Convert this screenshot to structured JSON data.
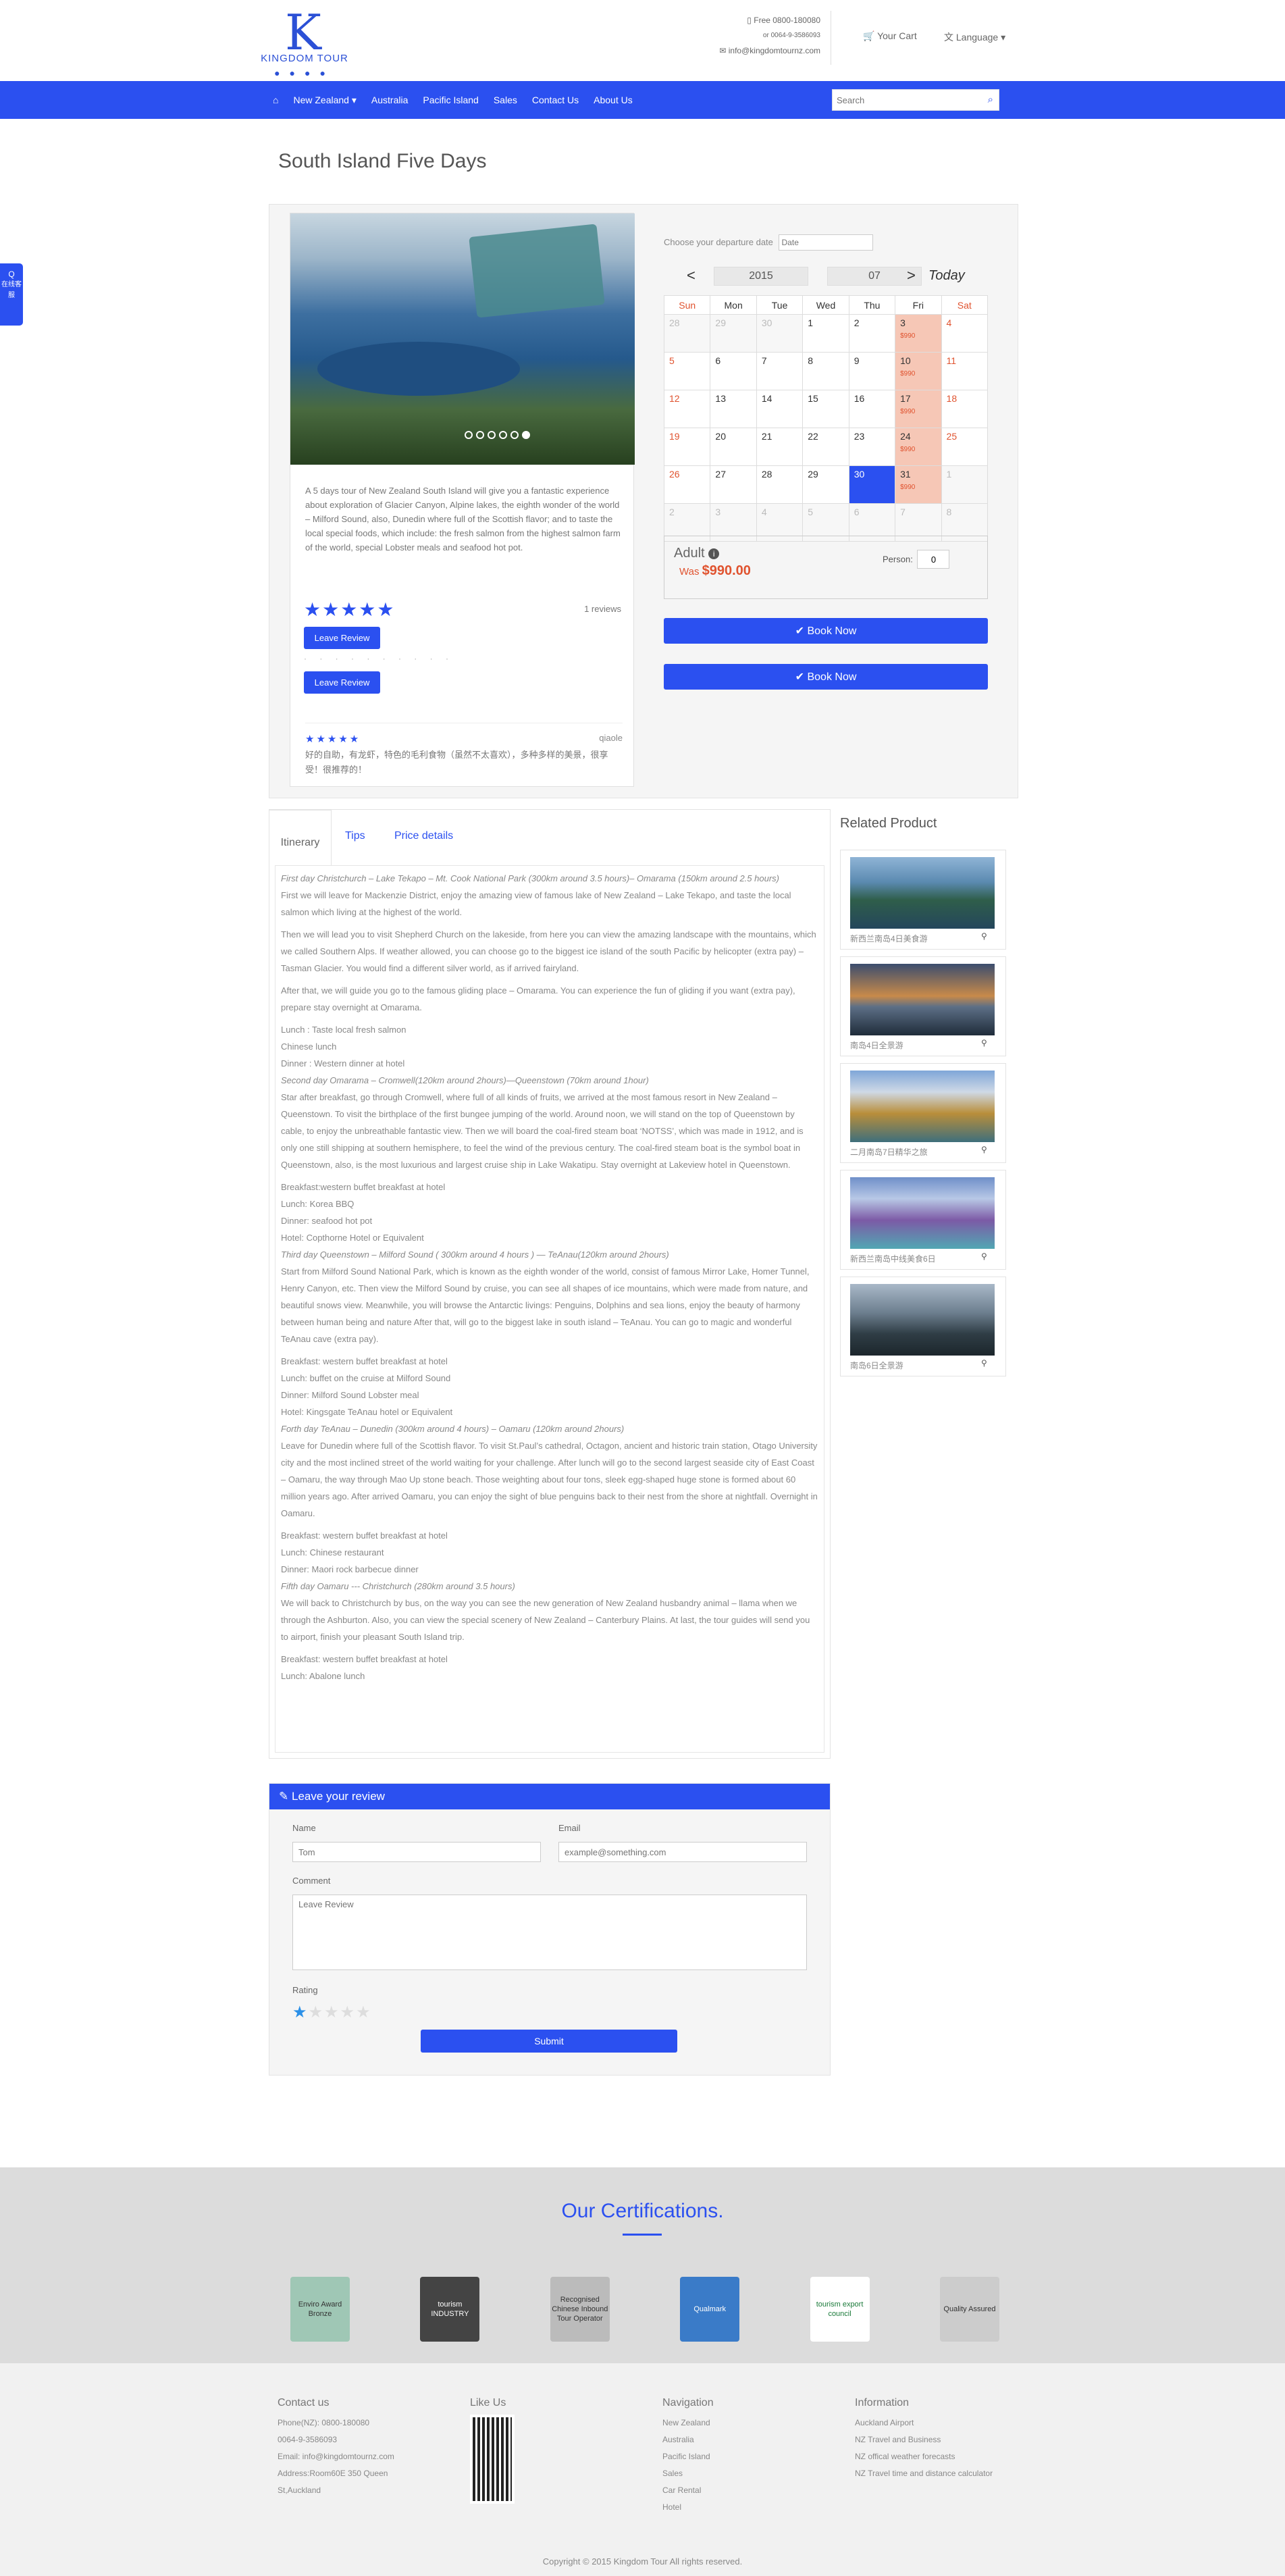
{
  "header": {
    "logo_text": "KINGDOM TOUR",
    "phone_free": "Free 0800-180080",
    "phone_intl": "or 0064-9-3586093",
    "email": "info@kingdomtournz.com",
    "cart": "Your Cart",
    "language": "Language"
  },
  "nav": {
    "items": [
      "New Zealand",
      "Australia",
      "Pacific Island",
      "Sales",
      "Contact Us",
      "About Us"
    ],
    "search_placeholder": "Search"
  },
  "side_tab": "在线客服",
  "page_title": "South Island Five Days",
  "product": {
    "description": "A 5 days tour of New Zealand South Island will give you a fantastic experience about exploration of Glacier Canyon, Alpine lakes, the eighth wonder of the world – Milford Sound, also, Dunedin where full of the Scottish flavor; and to taste the local special foods, which include: the fresh salmon from the highest salmon farm of the world, special Lobster meals and seafood hot pot.",
    "rating_stars": 5,
    "reviews_count": "1 reviews",
    "leave_review_label": "Leave Review",
    "review": {
      "stars": 5,
      "author": "qiaole",
      "text": "好的自助，有龙虾，特色的毛利食物（虽然不太喜欢），多种多样的美景，很享受！很推荐的！"
    }
  },
  "booking": {
    "choose_date_label": "Choose your departure date",
    "date_placeholder": "Date",
    "year": "2015",
    "month": "07",
    "prev": "<",
    "next": ">",
    "today": "Today",
    "weekdays": [
      "Sun",
      "Mon",
      "Tue",
      "Wed",
      "Thu",
      "Fri",
      "Sat"
    ],
    "weeks": [
      [
        {
          "d": "28",
          "o": true
        },
        {
          "d": "29",
          "o": true
        },
        {
          "d": "30",
          "o": true
        },
        {
          "d": "1"
        },
        {
          "d": "2"
        },
        {
          "d": "3",
          "a": true,
          "p": "$990"
        },
        {
          "d": "4"
        }
      ],
      [
        {
          "d": "5"
        },
        {
          "d": "6"
        },
        {
          "d": "7"
        },
        {
          "d": "8"
        },
        {
          "d": "9"
        },
        {
          "d": "10",
          "a": true,
          "p": "$990"
        },
        {
          "d": "11"
        }
      ],
      [
        {
          "d": "12"
        },
        {
          "d": "13"
        },
        {
          "d": "14"
        },
        {
          "d": "15"
        },
        {
          "d": "16"
        },
        {
          "d": "17",
          "a": true,
          "p": "$990"
        },
        {
          "d": "18"
        }
      ],
      [
        {
          "d": "19"
        },
        {
          "d": "20"
        },
        {
          "d": "21"
        },
        {
          "d": "22"
        },
        {
          "d": "23"
        },
        {
          "d": "24",
          "a": true,
          "p": "$990"
        },
        {
          "d": "25"
        }
      ],
      [
        {
          "d": "26"
        },
        {
          "d": "27"
        },
        {
          "d": "28"
        },
        {
          "d": "29"
        },
        {
          "d": "30",
          "s": true
        },
        {
          "d": "31",
          "a": true,
          "p": "$990"
        },
        {
          "d": "1",
          "o": true
        }
      ],
      [
        {
          "d": "2",
          "o": true
        },
        {
          "d": "3",
          "o": true
        },
        {
          "d": "4",
          "o": true
        },
        {
          "d": "5",
          "o": true
        },
        {
          "d": "6",
          "o": true
        },
        {
          "d": "7",
          "o": true
        },
        {
          "d": "8",
          "o": true
        }
      ]
    ],
    "adult_label": "Adult",
    "was_label": "Was",
    "price": "$990.00",
    "person_label": "Person",
    "person_value": "0",
    "book_label": "Book Now"
  },
  "tabs": [
    "Itinerary",
    "Tips",
    "Price details"
  ],
  "itinerary": [
    {
      "day": "First day    Christchurch – Lake Tekapo – Mt. Cook National Park (300km around 3.5 hours)– Omarama (150km around 2.5 hours)",
      "paras": [
        "First we will leave for Mackenzie District, enjoy the amazing view of famous lake of New Zealand – Lake Tekapo, and taste the local salmon which living at the highest of the world.",
        "Then we will lead you to visit Shepherd Church on the lakeside, from here you can view the amazing landscape with the mountains, which we called Southern Alps. If weather allowed, you can choose go to the biggest ice island of the south Pacific by helicopter (extra pay) – Tasman Glacier. You would find a different silver world, as if arrived fairyland.",
        "After that, we will guide you go to the famous gliding place – Omarama. You can experience the fun of gliding if you want (extra pay), prepare stay overnight at Omarama."
      ],
      "meals": [
        "Lunch : Taste local fresh salmon",
        "Chinese lunch",
        "Dinner : Western dinner at hotel"
      ]
    },
    {
      "day": "Second day    Omarama – Cromwell(120km around 2hours)—Queenstown (70km around 1hour)",
      "paras": [
        "Star after breakfast, go through Cromwell, where full of all kinds of fruits, we arrived at the most famous resort in New Zealand – Queenstown. To visit the birthplace of the first bungee jumping of the world. Around noon, we will stand on the top of Queenstown by cable, to enjoy the unbreathable fantastic view. Then we will board the coal-fired steam boat ‘NOTSS’, which was made in 1912, and is only one still shipping at southern hemisphere, to feel the wind of the previous century. The coal-fired steam boat is the symbol boat in Queenstown, also, is the most luxurious and largest cruise ship in Lake Wakatipu. Stay overnight at Lakeview hotel in Queenstown."
      ],
      "meals": [
        "Breakfast:western buffet breakfast at hotel",
        "Lunch: Korea BBQ",
        "Dinner: seafood hot pot",
        "Hotel: Copthorne Hotel or Equivalent"
      ]
    },
    {
      "day": "Third day    Queenstown – Milford Sound  ( 300km around 4 hours ) — TeAnau(120km around 2hours)",
      "paras": [
        "Start from Milford Sound National Park, which is known as the eighth wonder of the world, consist of famous Mirror Lake, Homer Tunnel, Henry Canyon, etc. Then view the Milford Sound by cruise, you can see all shapes of ice mountains, which were made from nature, and beautiful snows view. Meanwhile, you will browse the Antarctic livings: Penguins, Dolphins and sea lions, enjoy the beauty of harmony between human being and nature After that, will go to the biggest lake in south island – TeAnau. You can go to magic and wonderful TeAnau cave (extra pay)."
      ],
      "meals": [
        "Breakfast: western buffet breakfast at hotel",
        "Lunch: buffet on the cruise at Milford Sound",
        "Dinner: Milford Sound Lobster meal",
        "Hotel: Kingsgate TeAnau hotel or Equivalent"
      ]
    },
    {
      "day": "Forth day    TeAnau – Dunedin (300km around 4 hours) – Oamaru (120km around 2hours)",
      "paras": [
        "Leave for Dunedin where full of the Scottish flavor. To visit St.Paul’s cathedral, Octagon, ancient and historic train station, Otago University city and the most inclined street of the world waiting for your challenge. After lunch will go to the second largest seaside city of East Coast – Oamaru, the way through Mao Up stone beach. Those weighting about four tons, sleek egg-shaped huge stone is formed about 60 million years ago. After arrived Oamaru, you can enjoy the sight of blue penguins back to their nest from the shore at nightfall. Overnight in Oamaru."
      ],
      "meals": [
        "Breakfast: western buffet breakfast at hotel",
        "Lunch: Chinese restaurant",
        "Dinner: Maori rock barbecue dinner"
      ]
    },
    {
      "day": "Fifth day    Oamaru --- Christchurch (280km around 3.5 hours)",
      "paras": [
        "We will back to Christchurch by bus, on the way you can see the new generation of New Zealand husbandry animal – llama when we through the Ashburton. Also, you can view the special scenery of New Zealand – Canterbury Plains. At last, the tour guides will send you to airport, finish your pleasant South Island trip."
      ],
      "meals": [
        "Breakfast: western buffet breakfast at hotel",
        "Lunch: Abalone lunch"
      ]
    }
  ],
  "related": {
    "title": "Related Product",
    "items": [
      "新西兰南岛4日美食游",
      "南岛4日全景游",
      "二月南岛7日精华之旅",
      "新西兰南岛中线美食6日",
      "南岛6日全景游"
    ]
  },
  "review_form": {
    "title": "Leave your review",
    "name_label": "Name",
    "name_placeholder": "Tom",
    "email_label": "Email",
    "email_placeholder": "example@something.com",
    "comment_label": "Comment",
    "comment_placeholder": "Leave Review",
    "rating_label": "Rating",
    "rating_value": 1,
    "submit_label": "Submit"
  },
  "certifications": {
    "title": "Our Certifications.",
    "items": [
      "Enviro Award Bronze",
      "tourism INDUSTRY",
      "Recognised Chinese Inbound Tour Operator",
      "Qualmark",
      "tourism export council",
      "Quality Assured"
    ]
  },
  "footer": {
    "contact_title": "Contact us",
    "contact_lines": [
      "Phone(NZ): 0800-180080",
      "0064-9-3586093",
      "Email: info@kingdomtournz.com",
      "Address:Room60E 350 Queen",
      "St,Auckland"
    ],
    "like_title": "Like Us",
    "nav_title": "Navigation",
    "nav_links": [
      "New Zealand",
      "Australia",
      "Pacific Island",
      "Sales",
      "Car Rental",
      "Hotel"
    ],
    "info_title": "Information",
    "info_links": [
      "Auckland Airport",
      "NZ Travel and Business",
      "NZ offical weather forecasts",
      "NZ Travel time and distance calculator"
    ],
    "copyright": "Copyright © 2015 Kingdom Tour All rights reserved."
  },
  "colors": {
    "accent": "#2b50f0",
    "available": "#f6c7b6",
    "warning": "#e0532f"
  }
}
